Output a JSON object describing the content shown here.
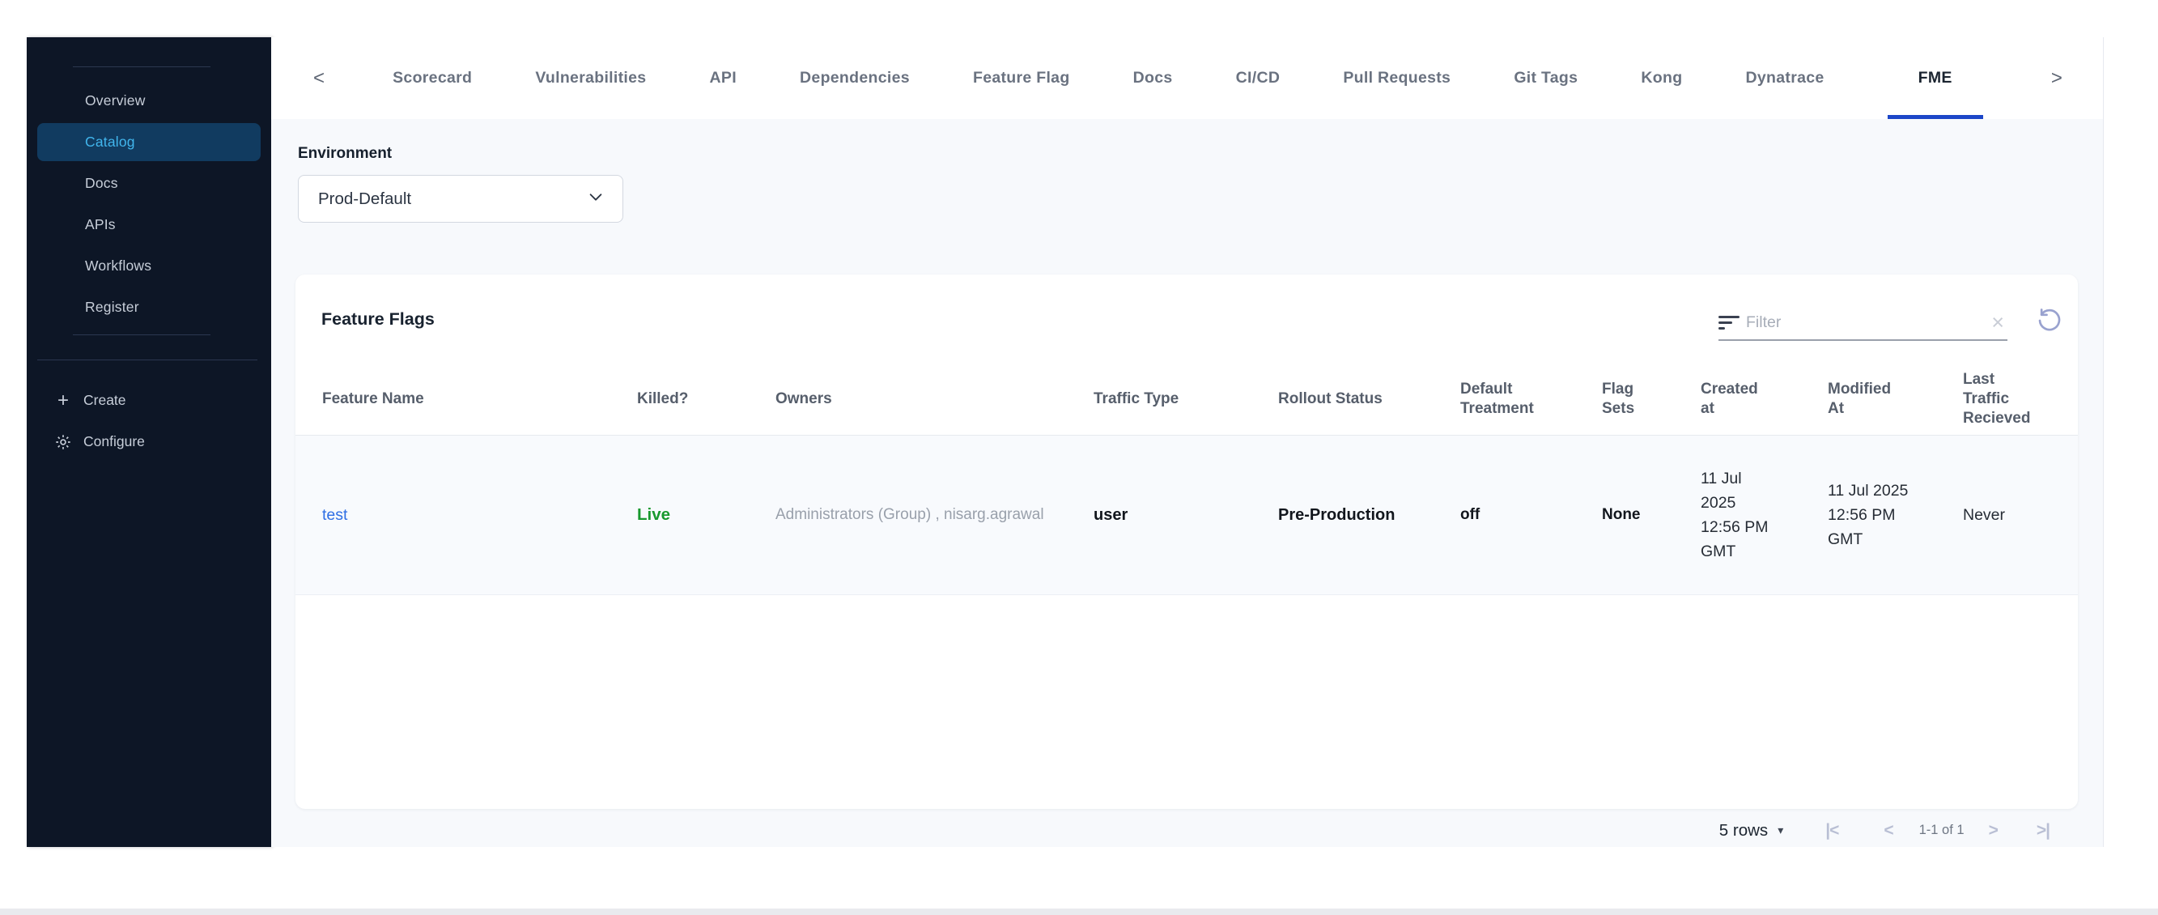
{
  "sidebar": {
    "items": [
      {
        "label": "Overview",
        "active": false
      },
      {
        "label": "Catalog",
        "active": true
      },
      {
        "label": "Docs",
        "active": false
      },
      {
        "label": "APIs",
        "active": false
      },
      {
        "label": "Workflows",
        "active": false
      },
      {
        "label": "Register",
        "active": false
      }
    ],
    "create_icon": "+",
    "create_label": "Create",
    "configure_label": "Configure"
  },
  "tabs": {
    "nav_left_icon": "<",
    "nav_right_icon": ">",
    "items": [
      "Scorecard",
      "Vulnerabilities",
      "API",
      "Dependencies",
      "Feature Flag",
      "Docs",
      "CI/CD",
      "Pull Requests",
      "Git Tags",
      "Kong",
      "Dynatrace",
      "FME"
    ],
    "active": "FME"
  },
  "environment": {
    "label": "Environment",
    "selected": "Prod-Default"
  },
  "feature_flags": {
    "title": "Feature Flags",
    "filter_placeholder": "Filter",
    "clear_icon": "×"
  },
  "table": {
    "columns": [
      "Feature Name",
      "Killed?",
      "Owners",
      "Traffic Type",
      "Rollout Status",
      "Default Treatment",
      "Flag Sets",
      "Created at",
      "Modified At",
      "Last Traffic Recieved"
    ],
    "rows": [
      {
        "cells": [
          "test",
          "Live",
          "Administrators (Group) , nisarg.agrawal",
          "user",
          "Pre-Production",
          "off",
          "None",
          "11 Jul\n2025\n12:56 PM\nGMT",
          "11 Jul 2025\n12:56 PM\nGMT",
          "Never"
        ]
      }
    ]
  },
  "pagination": {
    "rows_label": "5 rows",
    "caret_icon": "▾",
    "first_icon": "|<",
    "prev_icon": "<",
    "range": "1-1 of 1",
    "next_icon": ">",
    "last_icon": ">|"
  },
  "colors": {
    "sidebar_bg": "#0d1626",
    "sidebar_active_bg": "#113b60",
    "sidebar_active_text": "#41b5ec",
    "tab_underline": "#1c46c8",
    "link_blue": "#2e6ee4",
    "live_green": "#18992e",
    "page_bg": "#f7f9fc"
  }
}
